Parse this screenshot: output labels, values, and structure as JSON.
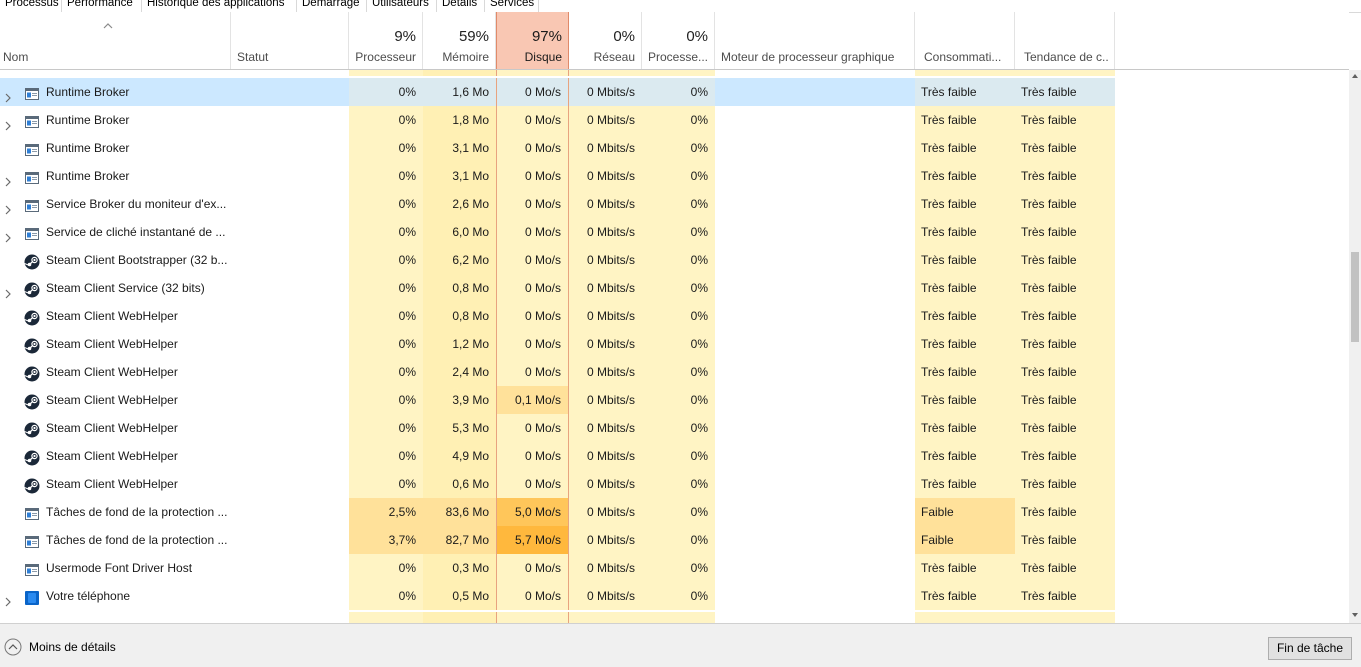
{
  "tabs": [
    "Processus",
    "Performance",
    "Historique des applications",
    "Démarrage",
    "Utilisateurs",
    "Détails",
    "Services"
  ],
  "header": {
    "name": "Nom",
    "status": "Statut",
    "cpu_pct": "9%",
    "cpu": "Processeur",
    "mem_pct": "59%",
    "mem": "Mémoire",
    "disk_pct": "97%",
    "disk": "Disque",
    "net_pct": "0%",
    "net": "Réseau",
    "gpu_pct": "0%",
    "gpu": "Processe...",
    "engine": "Moteur de processeur graphique",
    "power": "Consommati...",
    "trend": "Tendance de c..."
  },
  "rows": [
    {
      "name": "Runtime Broker",
      "expand": true,
      "icon": "app-window-icon",
      "cpu": "0%",
      "mem": "1,6 Mo",
      "disk": "0 Mo/s",
      "net": "0 Mbits/s",
      "gpu": "0%",
      "power": "Très faible",
      "trend": "Très faible",
      "selected": true
    },
    {
      "name": "Runtime Broker",
      "expand": true,
      "icon": "app-window-icon",
      "cpu": "0%",
      "mem": "1,8 Mo",
      "disk": "0 Mo/s",
      "net": "0 Mbits/s",
      "gpu": "0%",
      "power": "Très faible",
      "trend": "Très faible"
    },
    {
      "name": "Runtime Broker",
      "expand": false,
      "icon": "app-window-icon",
      "cpu": "0%",
      "mem": "3,1 Mo",
      "disk": "0 Mo/s",
      "net": "0 Mbits/s",
      "gpu": "0%",
      "power": "Très faible",
      "trend": "Très faible"
    },
    {
      "name": "Runtime Broker",
      "expand": true,
      "icon": "app-window-icon",
      "cpu": "0%",
      "mem": "3,1 Mo",
      "disk": "0 Mo/s",
      "net": "0 Mbits/s",
      "gpu": "0%",
      "power": "Très faible",
      "trend": "Très faible"
    },
    {
      "name": "Service Broker du moniteur d'ex...",
      "expand": true,
      "icon": "app-window-icon",
      "cpu": "0%",
      "mem": "2,6 Mo",
      "disk": "0 Mo/s",
      "net": "0 Mbits/s",
      "gpu": "0%",
      "power": "Très faible",
      "trend": "Très faible"
    },
    {
      "name": "Service de cliché instantané de ...",
      "expand": true,
      "icon": "app-window-icon",
      "cpu": "0%",
      "mem": "6,0 Mo",
      "disk": "0 Mo/s",
      "net": "0 Mbits/s",
      "gpu": "0%",
      "power": "Très faible",
      "trend": "Très faible"
    },
    {
      "name": "Steam Client Bootstrapper (32 b...",
      "expand": false,
      "icon": "steam-icon",
      "cpu": "0%",
      "mem": "6,2 Mo",
      "disk": "0 Mo/s",
      "net": "0 Mbits/s",
      "gpu": "0%",
      "power": "Très faible",
      "trend": "Très faible"
    },
    {
      "name": "Steam Client Service (32 bits)",
      "expand": true,
      "icon": "steam-icon",
      "cpu": "0%",
      "mem": "0,8 Mo",
      "disk": "0 Mo/s",
      "net": "0 Mbits/s",
      "gpu": "0%",
      "power": "Très faible",
      "trend": "Très faible"
    },
    {
      "name": "Steam Client WebHelper",
      "expand": false,
      "icon": "steam-icon",
      "cpu": "0%",
      "mem": "0,8 Mo",
      "disk": "0 Mo/s",
      "net": "0 Mbits/s",
      "gpu": "0%",
      "power": "Très faible",
      "trend": "Très faible"
    },
    {
      "name": "Steam Client WebHelper",
      "expand": false,
      "icon": "steam-icon",
      "cpu": "0%",
      "mem": "1,2 Mo",
      "disk": "0 Mo/s",
      "net": "0 Mbits/s",
      "gpu": "0%",
      "power": "Très faible",
      "trend": "Très faible"
    },
    {
      "name": "Steam Client WebHelper",
      "expand": false,
      "icon": "steam-icon",
      "cpu": "0%",
      "mem": "2,4 Mo",
      "disk": "0 Mo/s",
      "net": "0 Mbits/s",
      "gpu": "0%",
      "power": "Très faible",
      "trend": "Très faible"
    },
    {
      "name": "Steam Client WebHelper",
      "expand": false,
      "icon": "steam-icon",
      "cpu": "0%",
      "mem": "3,9 Mo",
      "disk": "0,1 Mo/s",
      "net": "0 Mbits/s",
      "gpu": "0%",
      "power": "Très faible",
      "trend": "Très faible",
      "disk_level": 1
    },
    {
      "name": "Steam Client WebHelper",
      "expand": false,
      "icon": "steam-icon",
      "cpu": "0%",
      "mem": "5,3 Mo",
      "disk": "0 Mo/s",
      "net": "0 Mbits/s",
      "gpu": "0%",
      "power": "Très faible",
      "trend": "Très faible"
    },
    {
      "name": "Steam Client WebHelper",
      "expand": false,
      "icon": "steam-icon",
      "cpu": "0%",
      "mem": "4,9 Mo",
      "disk": "0 Mo/s",
      "net": "0 Mbits/s",
      "gpu": "0%",
      "power": "Très faible",
      "trend": "Très faible"
    },
    {
      "name": "Steam Client WebHelper",
      "expand": false,
      "icon": "steam-icon",
      "cpu": "0%",
      "mem": "0,6 Mo",
      "disk": "0 Mo/s",
      "net": "0 Mbits/s",
      "gpu": "0%",
      "power": "Très faible",
      "trend": "Très faible"
    },
    {
      "name": "Tâches de fond de la protection ...",
      "expand": false,
      "icon": "app-window-icon",
      "cpu": "2,5%",
      "mem": "83,6 Mo",
      "disk": "5,0 Mo/s",
      "net": "0 Mbits/s",
      "gpu": "0%",
      "power": "Faible",
      "trend": "Très faible",
      "disk_level": 2,
      "hot": true
    },
    {
      "name": "Tâches de fond de la protection ...",
      "expand": false,
      "icon": "app-window-icon",
      "cpu": "3,7%",
      "mem": "82,7 Mo",
      "disk": "5,7 Mo/s",
      "net": "0 Mbits/s",
      "gpu": "0%",
      "power": "Faible",
      "trend": "Très faible",
      "disk_level": 3,
      "hot": true
    },
    {
      "name": "Usermode Font Driver Host",
      "expand": false,
      "icon": "app-window-icon",
      "cpu": "0%",
      "mem": "0,3 Mo",
      "disk": "0 Mo/s",
      "net": "0 Mbits/s",
      "gpu": "0%",
      "power": "Très faible",
      "trend": "Très faible"
    },
    {
      "name": "Votre téléphone",
      "expand": true,
      "icon": "phone-app-icon",
      "cpu": "0%",
      "mem": "0,5 Mo",
      "disk": "0 Mo/s",
      "net": "0 Mbits/s",
      "gpu": "0%",
      "power": "Très faible",
      "trend": "Très faible"
    }
  ],
  "footer": {
    "less_details": "Moins de détails",
    "end_task": "Fin de tâche"
  },
  "colors": {
    "heat_light": "#fff4c4",
    "heat_mem": "#fff0b4",
    "heat_mid": "#ffe19a",
    "heat_high": "#ffc65a",
    "heat_max": "#ffb83d",
    "disk_header": "#f9c7b3",
    "selection": "#cce8ff"
  }
}
